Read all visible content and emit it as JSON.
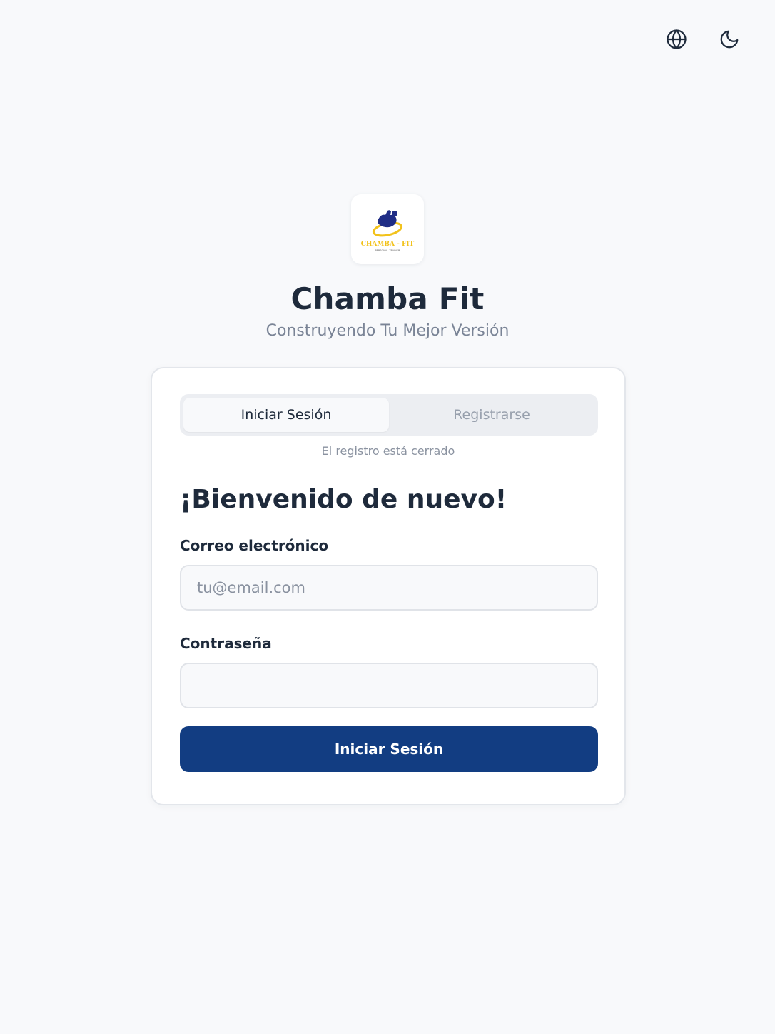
{
  "header": {
    "language_icon": "globe-icon",
    "theme_icon": "moon-icon"
  },
  "brand": {
    "logo_text": "CHAMBA - FIT",
    "logo_subtext": "PERSONAL TRAINER",
    "title": "Chamba Fit",
    "tagline": "Construyendo Tu Mejor Versión"
  },
  "auth": {
    "tabs": [
      {
        "label": "Iniciar Sesión",
        "active": true
      },
      {
        "label": "Registrarse",
        "active": false
      }
    ],
    "registration_note": "El registro está cerrado",
    "welcome_heading": "¡Bienvenido de nuevo!",
    "email": {
      "label": "Correo electrónico",
      "placeholder": "tu@email.com",
      "value": ""
    },
    "password": {
      "label": "Contraseña",
      "placeholder": "",
      "value": ""
    },
    "submit_label": "Iniciar Sesión"
  },
  "colors": {
    "background": "#f8f9fb",
    "primary": "#123d82",
    "text": "#1e2a3b",
    "muted": "#7a8496",
    "logo_blue": "#1f2d86",
    "logo_yellow": "#f2c21b"
  }
}
